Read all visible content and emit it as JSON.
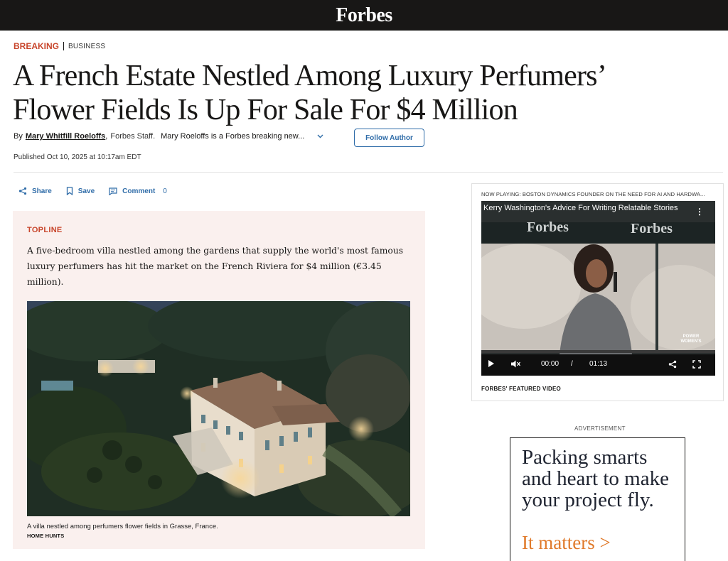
{
  "header": {
    "logo": "Forbes"
  },
  "article": {
    "kicker": {
      "breaking": "BREAKING",
      "category": "BUSINESS"
    },
    "headline_line1": "A French Estate Nestled Among Luxury Perfumers’",
    "headline_line2": "Flower Fields Is Up For Sale For $4 Million",
    "byline": {
      "by": "By",
      "author": "Mary Whitfill Roeloffs",
      "comma": ",",
      "staff": "Forbes Staff.",
      "bio": "Mary Roeloffs is a Forbes breaking new...",
      "follow_label": "Follow Author"
    },
    "published": "Published Oct 10, 2025 at 10:17am EDT",
    "actions": {
      "share": "Share",
      "save": "Save",
      "comment": "Comment",
      "comment_count": "0"
    },
    "topline": {
      "label": "TOPLINE",
      "text": "A five-bedroom villa nestled among the gardens that supply the world's most famous luxury perfumers has hit the market on the French Riviera for $4 million (€3.45 million).",
      "caption": "A villa nestled among perfumers flower fields in Grasse, France.",
      "credit": "HOME HUNTS"
    }
  },
  "video": {
    "now_playing": "NOW PLAYING: BOSTON DYNAMICS FOUNDER ON THE NEED FOR AI AND HARDWA...",
    "title": "Kerry Washington's Advice For Writing Relatable Stories",
    "backdrop_logo": "Forbes",
    "time_current": "00:00",
    "time_sep": "/",
    "time_total": "01:13",
    "featured_label": "FORBES' FEATURED VIDEO",
    "watermark": "POWER WOMEN'S"
  },
  "ad": {
    "label": "ADVERTISEMENT",
    "headline": "Packing smarts and heart to make your project fly.",
    "cta": "It matters >"
  },
  "colors": {
    "accent_red": "#c8462c",
    "link_blue": "#2f6ca8",
    "topline_bg": "#faf0ee",
    "ad_orange": "#e07a2b"
  }
}
